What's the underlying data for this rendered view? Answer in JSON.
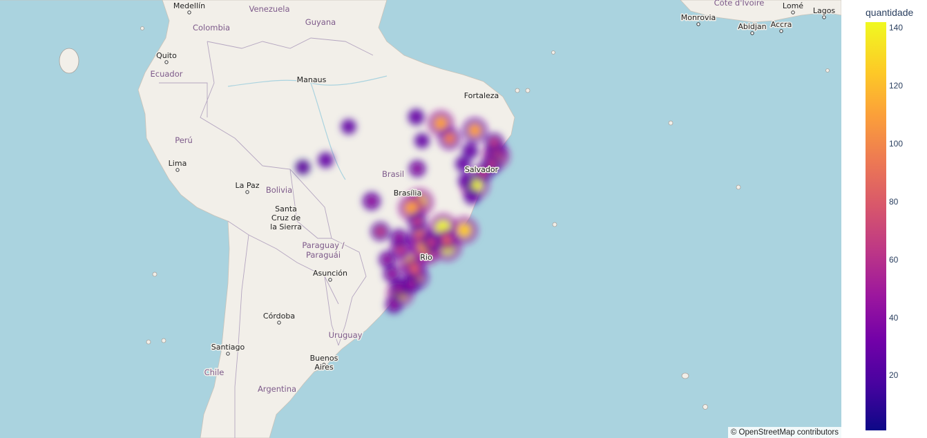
{
  "map": {
    "attribution": "© OpenStreetMap contributors",
    "place_labels": [
      {
        "text": "Medellín",
        "kind": "city"
      },
      {
        "text": "Venezuela",
        "kind": "country"
      },
      {
        "text": "Colombia",
        "kind": "country"
      },
      {
        "text": "Guyana",
        "kind": "country"
      },
      {
        "text": "Quito",
        "kind": "city"
      },
      {
        "text": "Ecuador",
        "kind": "country"
      },
      {
        "text": "Manaus",
        "kind": "city"
      },
      {
        "text": "Fortaleza",
        "kind": "city"
      },
      {
        "text": "Perú",
        "kind": "country"
      },
      {
        "text": "Lima",
        "kind": "city"
      },
      {
        "text": "Brasil",
        "kind": "country"
      },
      {
        "text": "Salvador",
        "kind": "city"
      },
      {
        "text": "La Paz",
        "kind": "city"
      },
      {
        "text": "Bolivia",
        "kind": "country"
      },
      {
        "text": "Santa",
        "kind": "city"
      },
      {
        "text": "Cruz de",
        "kind": "city"
      },
      {
        "text": "la Sierra",
        "kind": "city"
      },
      {
        "text": "Paraguay /",
        "kind": "country"
      },
      {
        "text": "Paraguái",
        "kind": "country"
      },
      {
        "text": "Asunción",
        "kind": "city"
      },
      {
        "text": "Córdoba",
        "kind": "city"
      },
      {
        "text": "Santiago",
        "kind": "city"
      },
      {
        "text": "Uruguay",
        "kind": "country"
      },
      {
        "text": "Buenos",
        "kind": "city"
      },
      {
        "text": "Aires",
        "kind": "city"
      },
      {
        "text": "Chile",
        "kind": "country"
      },
      {
        "text": "Argentina",
        "kind": "country"
      },
      {
        "text": "Monrovia",
        "kind": "city"
      },
      {
        "text": "Côte d'Ivoire",
        "kind": "country"
      },
      {
        "text": "Abidjan",
        "kind": "city"
      },
      {
        "text": "Accra",
        "kind": "city"
      },
      {
        "text": "Lomé",
        "kind": "city"
      },
      {
        "text": "Lagos",
        "kind": "city"
      },
      {
        "text": "Brasília",
        "kind": "city"
      },
      {
        "text": "Rio",
        "kind": "city"
      }
    ]
  },
  "colorbar": {
    "title": "quantidade",
    "min": 1,
    "max": 142,
    "ticks": [
      20,
      40,
      60,
      80,
      100,
      120,
      140
    ],
    "colorscale": [
      "#0d0887",
      "#46039f",
      "#7201a8",
      "#9c179e",
      "#bd3786",
      "#d8576b",
      "#ed7953",
      "#fb9f3a",
      "#fdca26",
      "#f0f921"
    ]
  },
  "colors": {
    "ocean": "#aad3df",
    "land": "#f2efe9",
    "border": "#b4a5c0"
  },
  "heat_points": [
    {
      "lat": -22.9,
      "lon": -43.2,
      "q": 140
    },
    {
      "lat": -23.5,
      "lon": -46.6,
      "q": 142
    },
    {
      "lat": -19.9,
      "lon": -43.9,
      "q": 135
    },
    {
      "lat": -15.8,
      "lon": -47.9,
      "q": 130
    },
    {
      "lat": -12.97,
      "lon": -38.5,
      "q": 138
    },
    {
      "lat": -25.4,
      "lon": -49.3,
      "q": 120
    },
    {
      "lat": -27.6,
      "lon": -48.5,
      "q": 110
    },
    {
      "lat": -30.0,
      "lon": -51.2,
      "q": 125
    },
    {
      "lat": -8.05,
      "lon": -34.9,
      "q": 128
    },
    {
      "lat": -3.72,
      "lon": -38.5,
      "q": 110
    },
    {
      "lat": -2.53,
      "lon": -44.3,
      "q": 115
    },
    {
      "lat": -3.1,
      "lon": -60.0,
      "q": 30
    },
    {
      "lat": -16.7,
      "lon": -49.3,
      "q": 118
    },
    {
      "lat": -20.3,
      "lon": -40.3,
      "q": 125
    },
    {
      "lat": -22.0,
      "lon": -47.9,
      "q": 100
    },
    {
      "lat": -21.2,
      "lon": -47.8,
      "q": 95
    },
    {
      "lat": -22.9,
      "lon": -47.1,
      "q": 115
    },
    {
      "lat": -23.3,
      "lon": -51.2,
      "q": 70
    },
    {
      "lat": -20.5,
      "lon": -54.6,
      "q": 60
    },
    {
      "lat": -15.6,
      "lon": -56.1,
      "q": 55
    },
    {
      "lat": -5.1,
      "lon": -42.8,
      "q": 90
    },
    {
      "lat": -9.6,
      "lon": -35.7,
      "q": 65
    },
    {
      "lat": -7.1,
      "lon": -34.9,
      "q": 70
    },
    {
      "lat": -5.8,
      "lon": -35.2,
      "q": 60
    },
    {
      "lat": -10.9,
      "lon": -37.1,
      "q": 60
    },
    {
      "lat": -9.97,
      "lon": -67.8,
      "q": 25
    },
    {
      "lat": -8.76,
      "lon": -63.9,
      "q": 35
    },
    {
      "lat": -1.45,
      "lon": -48.5,
      "q": 40
    },
    {
      "lat": -26.3,
      "lon": -48.8,
      "q": 80
    },
    {
      "lat": -29.2,
      "lon": -51.2,
      "q": 55
    },
    {
      "lat": -31.7,
      "lon": -52.3,
      "q": 45
    },
    {
      "lat": -24.9,
      "lon": -53.4,
      "q": 45
    },
    {
      "lat": -21.8,
      "lon": -43.3,
      "q": 75
    },
    {
      "lat": -18.9,
      "lon": -48.3,
      "q": 60
    },
    {
      "lat": -10.2,
      "lon": -48.3,
      "q": 45
    },
    {
      "lat": -14.8,
      "lon": -39.0,
      "q": 40
    },
    {
      "lat": -12.2,
      "lon": -40.0,
      "q": 35
    },
    {
      "lat": -9.4,
      "lon": -40.5,
      "q": 35
    },
    {
      "lat": -7.2,
      "lon": -39.3,
      "q": 40
    },
    {
      "lat": -5.5,
      "lon": -47.5,
      "q": 30
    },
    {
      "lat": -22.2,
      "lon": -45.9,
      "q": 65
    },
    {
      "lat": -21.5,
      "lon": -51.4,
      "q": 50
    },
    {
      "lat": -27.1,
      "lon": -52.6,
      "q": 50
    },
    {
      "lat": -28.7,
      "lon": -49.4,
      "q": 55
    }
  ]
}
